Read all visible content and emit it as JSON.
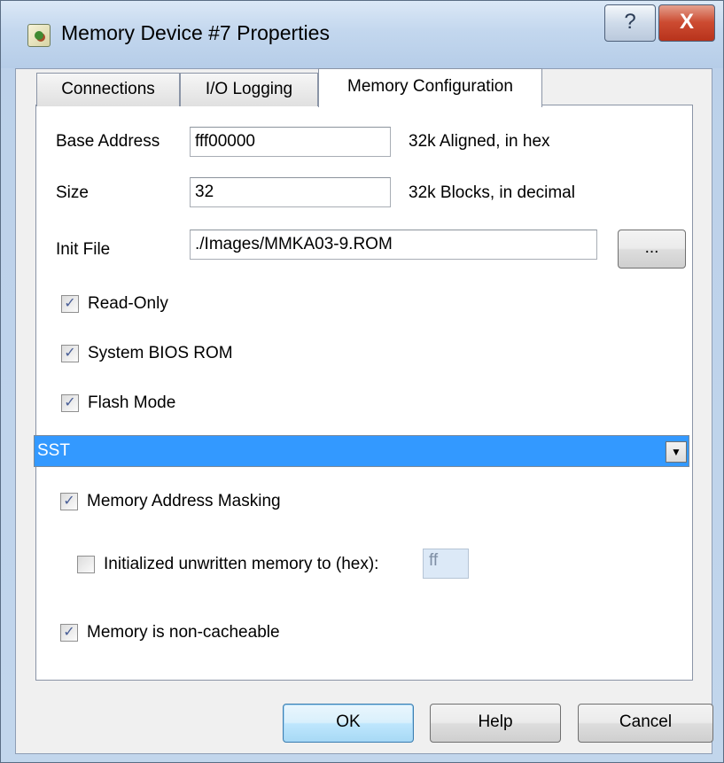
{
  "window": {
    "title": "Memory Device #7 Properties",
    "help_glyph": "?",
    "close_glyph": "X"
  },
  "tabs": [
    {
      "label": "Connections",
      "active": false
    },
    {
      "label": "I/O Logging",
      "active": false
    },
    {
      "label": "Memory Configuration",
      "active": true
    }
  ],
  "form": {
    "base_address": {
      "label": "Base Address",
      "value": "fff00000",
      "hint": "32k Aligned, in hex"
    },
    "size": {
      "label": "Size",
      "value": "32",
      "hint": "32k Blocks, in decimal"
    },
    "init_file": {
      "label": "Init File",
      "value": "./Images/MMKA03-9.ROM",
      "browse_label": "..."
    },
    "read_only": {
      "label": "Read-Only",
      "checked": true
    },
    "system_bios_rom": {
      "label": "System BIOS ROM",
      "checked": true
    },
    "flash_mode": {
      "label": "Flash Mode",
      "checked": true
    },
    "flash_type": {
      "selected": "SST"
    },
    "address_masking": {
      "label": "Memory Address Masking",
      "checked": true
    },
    "init_unwritten": {
      "label": "Initialized unwritten memory to (hex):",
      "checked": false,
      "value": "ff"
    },
    "non_cacheable": {
      "label": "Memory is non-cacheable",
      "checked": true
    }
  },
  "buttons": {
    "ok": "OK",
    "help": "Help",
    "cancel": "Cancel"
  },
  "colors": {
    "selection": "#3399ff",
    "check_mark": "#4a5f97",
    "close_button": "#c9452d"
  },
  "icons": {
    "window": "app-icon",
    "checked": "checkmark-icon",
    "dropdown": "chevron-down-icon"
  }
}
